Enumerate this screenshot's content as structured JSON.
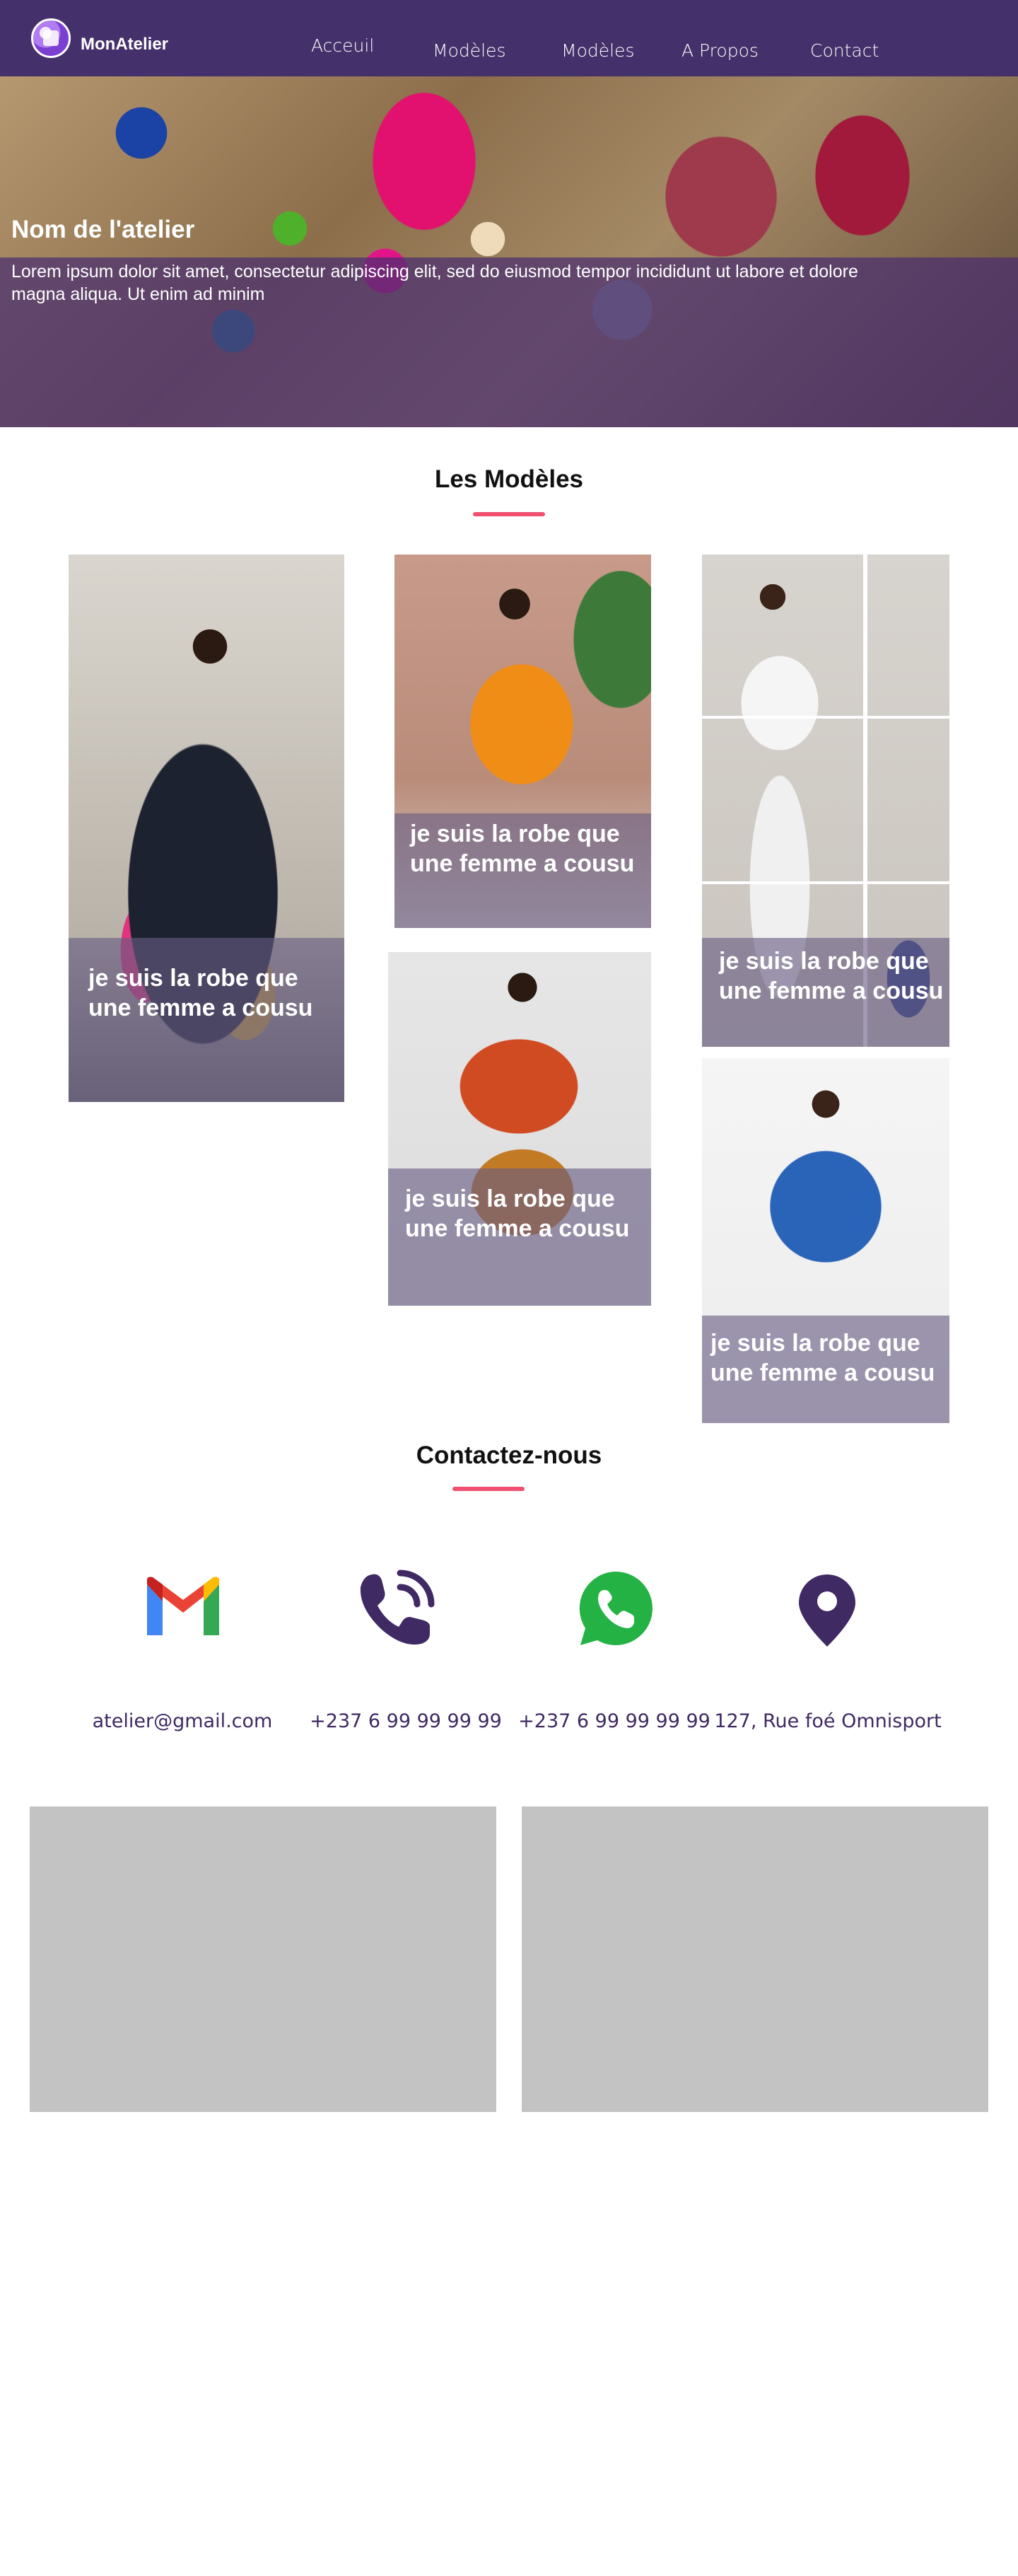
{
  "header": {
    "brand": "MonAtelier",
    "nav": [
      "Acceuil",
      "Modèles",
      "Modèles",
      "A Propos",
      "Contact"
    ]
  },
  "hero": {
    "title": "Nom de l'atelier",
    "text": "Lorem ipsum dolor sit amet, consectetur adipiscing elit, sed do eiusmod tempor incididunt ut labore et dolore magna aliqua. Ut enim ad minim"
  },
  "models": {
    "title": "Les Modèles",
    "cards": [
      "je suis la robe que une femme a cousu",
      "je suis la robe que une femme a cousu",
      "je suis la robe que une femme a cousu",
      "je suis la robe que une femme a cousu",
      "je suis la robe que une femme a cousu"
    ]
  },
  "contact": {
    "title": "Contactez-nous",
    "items": [
      {
        "icon": "gmail-icon",
        "text": "atelier@gmail.com"
      },
      {
        "icon": "phone-icon",
        "text": "+237 6 99 99 99 99"
      },
      {
        "icon": "whatsapp-icon",
        "text": "+237 6 99 99 99 99"
      },
      {
        "icon": "location-pin-icon",
        "text": "127, Rue foé Omnisport"
      }
    ]
  },
  "colors": {
    "nav_bg": "#44306a",
    "accent": "#f0506e",
    "icon_purple": "#3f2a63",
    "placeholder_gray": "#c3c3c3"
  }
}
